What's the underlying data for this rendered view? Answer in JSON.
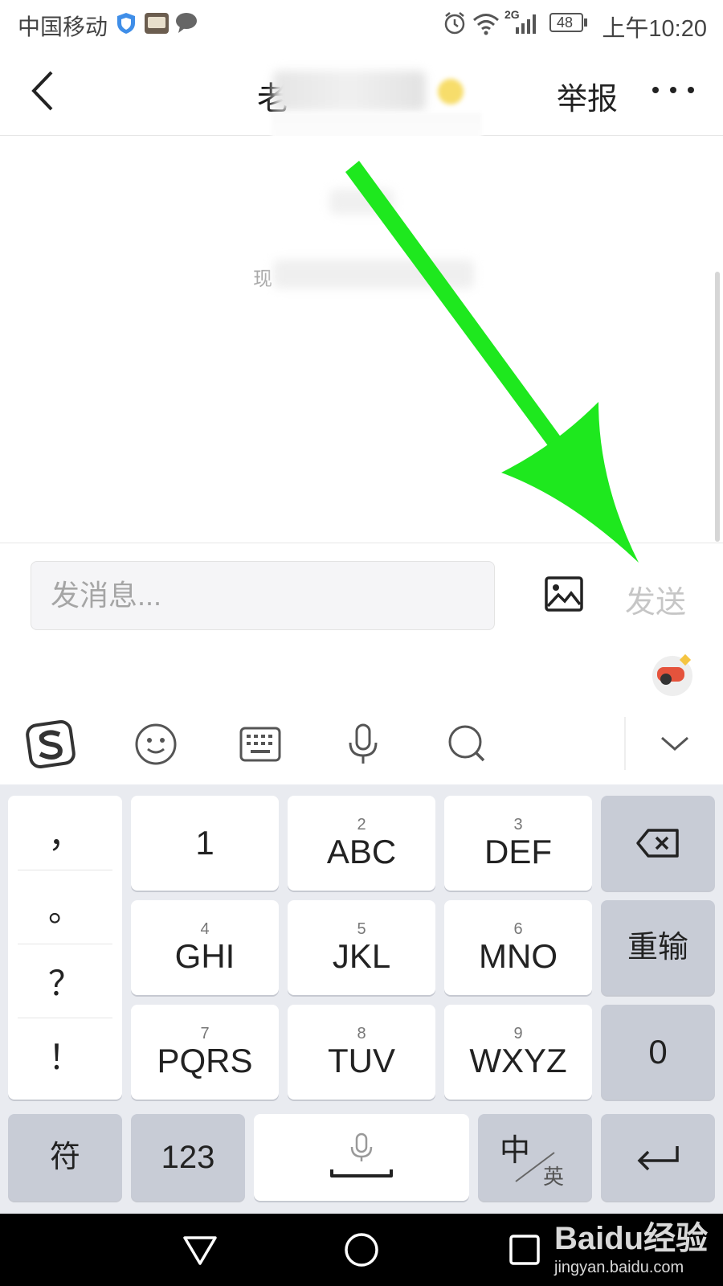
{
  "status_bar": {
    "carrier": "中国移动",
    "signal_label": "2G",
    "battery": "48",
    "time": "上午10:20",
    "icons": [
      "shield-icon",
      "toutiao-icon",
      "chat-bubble-icon",
      "alarm-icon",
      "wifi-icon",
      "signal-icon",
      "battery-icon"
    ]
  },
  "header": {
    "title_visible": "老",
    "report": "举报",
    "icons": [
      "back-arrow-icon",
      "more-icon"
    ]
  },
  "chat": {
    "notice_visible": "现"
  },
  "input_bar": {
    "placeholder": "发消息...",
    "send_label": "发送",
    "image_icon": "image-icon"
  },
  "ime_toolbar": {
    "icons": [
      "sogou-logo-icon",
      "emoji-icon",
      "keyboard-icon",
      "microphone-icon",
      "search-icon",
      "chevron-down-icon"
    ],
    "mascot": "sogou-mascot-icon"
  },
  "keyboard": {
    "punctuation": [
      "，",
      "。",
      "？",
      "！"
    ],
    "rows": [
      [
        {
          "num": "",
          "letters": "1"
        },
        {
          "num": "2",
          "letters": "ABC"
        },
        {
          "num": "3",
          "letters": "DEF"
        }
      ],
      [
        {
          "num": "4",
          "letters": "GHI"
        },
        {
          "num": "5",
          "letters": "JKL"
        },
        {
          "num": "6",
          "letters": "MNO"
        }
      ],
      [
        {
          "num": "7",
          "letters": "PQRS"
        },
        {
          "num": "8",
          "letters": "TUV"
        },
        {
          "num": "9",
          "letters": "WXYZ"
        }
      ]
    ],
    "right_keys": {
      "backspace_icon": "backspace-icon",
      "retype": "重输",
      "zero": "0",
      "enter_icon": "enter-icon"
    },
    "bottom": {
      "symbols": "符",
      "numbers": "123",
      "space_icon": "microphone-icon",
      "lang_main": "中",
      "lang_sub": "英"
    }
  },
  "nav_bar": {
    "icons": [
      "back-triangle-icon",
      "home-circle-icon",
      "recents-square-icon"
    ]
  },
  "watermark": {
    "brand": "Baidu经验",
    "url": "jingyan.baidu.com"
  },
  "colors": {
    "arrow": "#1ee81e",
    "keyboard_bg": "#e9ebf0",
    "gray_key": "#c8ccd6",
    "send_disabled": "#c6c6c6"
  }
}
